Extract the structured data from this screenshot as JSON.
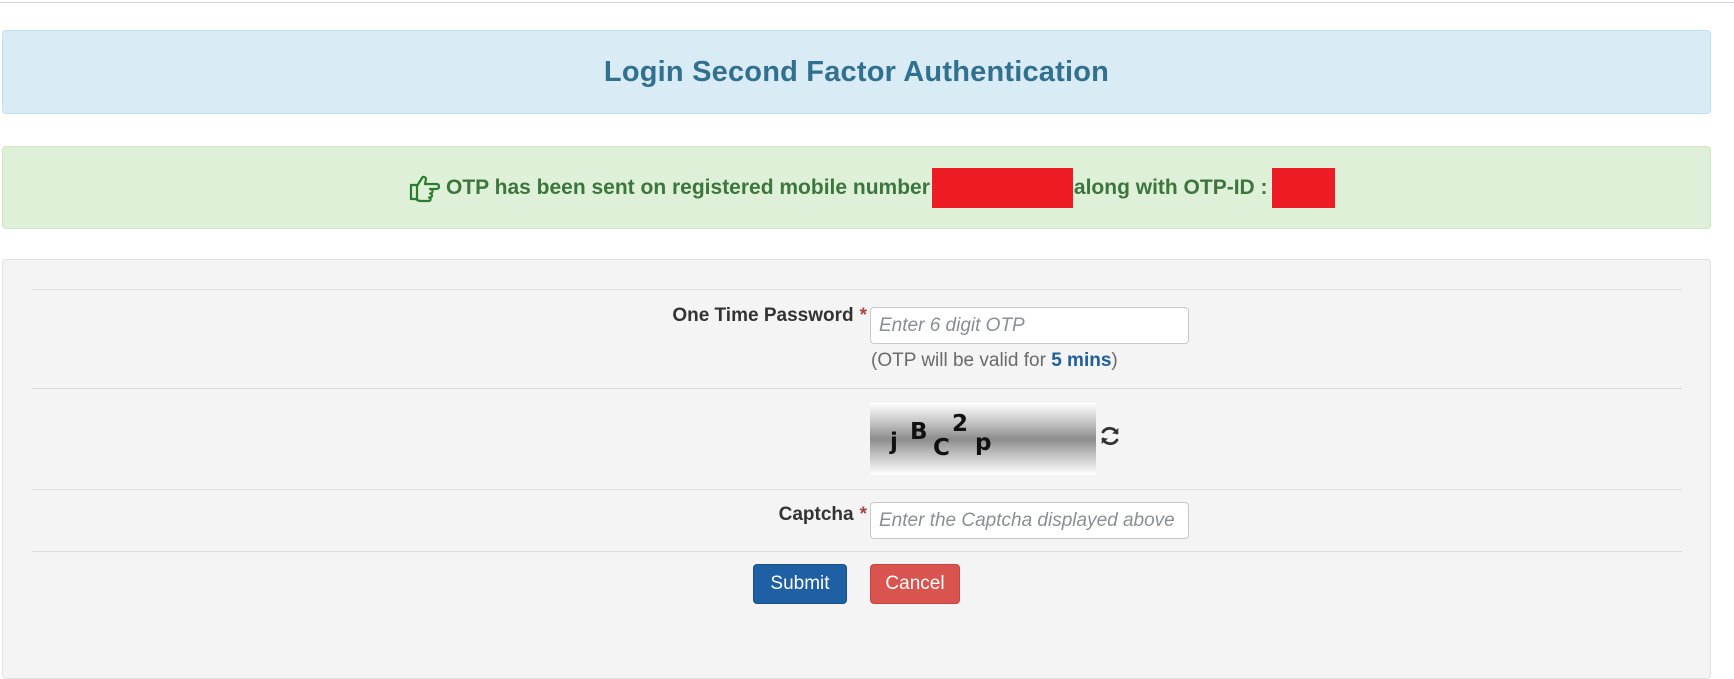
{
  "header": {
    "title": "Login Second Factor Authentication"
  },
  "alert": {
    "message": "OTP has been sent on registered mobile number",
    "middle_text": "along with OTP-ID :",
    "icon": "hand-pointing-right-icon",
    "color": "#3c763d"
  },
  "form": {
    "otp": {
      "label": "One Time Password",
      "required_mark": "*",
      "placeholder": "Enter 6 digit OTP",
      "value": "",
      "help_prefix": "(OTP will be valid for ",
      "help_highlight": "5 mins",
      "help_suffix": ")"
    },
    "captcha_image": {
      "characters": [
        "j",
        "B",
        "C",
        "2",
        "p"
      ],
      "refresh_icon": "refresh-icon"
    },
    "captcha": {
      "label": "Captcha",
      "required_mark": "*",
      "placeholder": "Enter the Captcha displayed above",
      "value": ""
    },
    "buttons": {
      "submit_label": "Submit",
      "cancel_label": "Cancel"
    }
  },
  "colors": {
    "heading_bg": "#d9ecf6",
    "heading_text": "#31708f",
    "alert_bg": "#dff0d8",
    "submit_bg": "#1f5fa3",
    "cancel_bg": "#d9534f",
    "redaction": "#ed1c24"
  }
}
